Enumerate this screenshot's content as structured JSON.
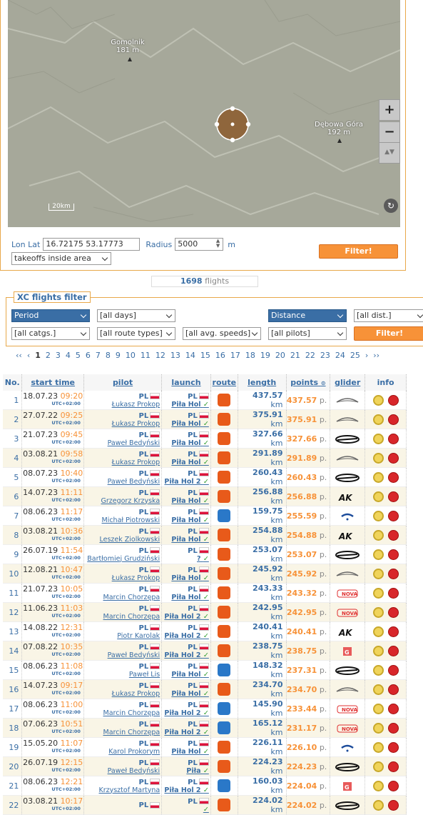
{
  "map": {
    "labels": [
      {
        "name": "Gomolnik",
        "sub": "181 m"
      },
      {
        "name": "Dębowa Góra",
        "sub": "192 m"
      }
    ],
    "scale": "20km",
    "zoom_in": "+",
    "zoom_out": "−",
    "rotate": "▲▼"
  },
  "filter_area": {
    "lonlat_label": "Lon Lat",
    "lonlat_value": "16.72175 53.17773",
    "radius_label": "Radius",
    "radius_value": "5000",
    "unit": "m",
    "mode": "takeoffs inside area",
    "button": "Filter!"
  },
  "flights_count": {
    "value": "1698",
    "label": "flights"
  },
  "xc_filter": {
    "title": "XC flights filter",
    "period": "Period",
    "days": "[all days]",
    "distance": "Distance",
    "dist": "[all dist.]",
    "catgs": "[all catgs.]",
    "route_types": "[all route types]",
    "avg_speeds": "[all avg. speeds]",
    "pilots": "[all pilots]",
    "button": "Filter!"
  },
  "pager": {
    "first": "‹‹",
    "prev": "‹",
    "pages": [
      "1",
      "2",
      "3",
      "4",
      "5",
      "6",
      "7",
      "8",
      "9",
      "10",
      "11",
      "12",
      "13",
      "14",
      "15",
      "16",
      "17",
      "18",
      "19",
      "20",
      "21",
      "22",
      "23",
      "24",
      "25"
    ],
    "current": "1",
    "next": "›",
    "last": "››"
  },
  "table": {
    "headers": {
      "no": "No.",
      "start": "start time",
      "pilot": "pilot",
      "launch": "launch",
      "route": "route",
      "length": "length",
      "points": "points",
      "glider": "glider",
      "info": "info"
    },
    "utc": "UTC+02:00",
    "km": "km",
    "p": "p.",
    "rows": [
      {
        "no": "1",
        "date": "18.07.23",
        "time": "09:20",
        "pcc": "PL",
        "pilot": "Łukasz Prokop",
        "lcc": "PL",
        "launch": "Piła Hol",
        "route": "r",
        "len": "437.57",
        "pts": "437.57",
        "glider": "ozone-outline"
      },
      {
        "no": "2",
        "date": "27.07.22",
        "time": "09:25",
        "pcc": "PL",
        "pilot": "Łukasz Prokop",
        "lcc": "PL",
        "launch": "Piła Hol",
        "route": "r",
        "len": "375.91",
        "pts": "375.91",
        "glider": "ozone-outline"
      },
      {
        "no": "3",
        "date": "21.07.23",
        "time": "09:45",
        "pcc": "PL",
        "pilot": "Paweł Bedyński",
        "lcc": "PL",
        "launch": "Piła Hol",
        "route": "r",
        "len": "327.66",
        "pts": "327.66",
        "glider": "ozone"
      },
      {
        "no": "4",
        "date": "03.08.21",
        "time": "09:58",
        "pcc": "PL",
        "pilot": "Łukasz Prokop",
        "lcc": "PL",
        "launch": "Piła Hol",
        "route": "r",
        "len": "291.89",
        "pts": "291.89",
        "glider": "ozone-outline"
      },
      {
        "no": "5",
        "date": "08.07.23",
        "time": "10:40",
        "pcc": "PL",
        "pilot": "Paweł Bedyński",
        "lcc": "PL",
        "launch": "Piła Hol 2",
        "route": "r",
        "len": "260.43",
        "pts": "260.43",
        "glider": "ozone"
      },
      {
        "no": "6",
        "date": "14.07.23",
        "time": "11:11",
        "pcc": "PL",
        "pilot": "Grzegorz Krzyska",
        "lcc": "PL",
        "launch": "Piła Hol",
        "route": "r",
        "len": "256.88",
        "pts": "256.88",
        "glider": "advance"
      },
      {
        "no": "7",
        "date": "08.06.23",
        "time": "11:17",
        "pcc": "PL",
        "pilot": "Michał Piotrowski",
        "lcc": "PL",
        "launch": "Piła Hol",
        "route": "b",
        "len": "159.75",
        "pts": "255.59",
        "glider": "skywalk"
      },
      {
        "no": "8",
        "date": "03.08.21",
        "time": "10:36",
        "pcc": "PL",
        "pilot": "Leszek Ziolkowski",
        "lcc": "PL",
        "launch": "Piła Hol",
        "route": "r",
        "len": "254.88",
        "pts": "254.88",
        "glider": "advance"
      },
      {
        "no": "9",
        "date": "26.07.19",
        "time": "11:54",
        "pcc": "PL",
        "pilot": "Bartłomiej Grudziński",
        "lcc": "PL",
        "launch": "?",
        "route": "r",
        "len": "253.07",
        "pts": "253.07",
        "glider": "ozone"
      },
      {
        "no": "10",
        "date": "12.08.21",
        "time": "10:47",
        "pcc": "PL",
        "pilot": "Łukasz Prokop",
        "lcc": "PL",
        "launch": "Piła Hol",
        "route": "r",
        "len": "245.92",
        "pts": "245.92",
        "glider": "ozone-outline"
      },
      {
        "no": "11",
        "date": "21.07.23",
        "time": "10:05",
        "pcc": "PL",
        "pilot": "Marcin Chorzępa",
        "lcc": "PL",
        "launch": "Piła Hol",
        "route": "r",
        "len": "243.33",
        "pts": "243.32",
        "glider": "nova"
      },
      {
        "no": "12",
        "date": "11.06.23",
        "time": "11:03",
        "pcc": "PL",
        "pilot": "Marcin Chorzępa",
        "lcc": "PL",
        "launch": "Piła Hol 2",
        "route": "r",
        "len": "242.95",
        "pts": "242.95",
        "glider": "nova"
      },
      {
        "no": "13",
        "date": "14.08.22",
        "time": "12:31",
        "pcc": "PL",
        "pilot": "Piotr Karolak",
        "lcc": "PL",
        "launch": "Piła Hol 2",
        "route": "r",
        "len": "240.41",
        "pts": "240.41",
        "glider": "advance"
      },
      {
        "no": "14",
        "date": "07.08.22",
        "time": "10:35",
        "pcc": "PL",
        "pilot": "Paweł Bedyński",
        "lcc": "PL",
        "launch": "Piła Hol 2",
        "route": "r",
        "len": "238.75",
        "pts": "238.75",
        "glider": "gin"
      },
      {
        "no": "15",
        "date": "08.06.23",
        "time": "11:08",
        "pcc": "PL",
        "pilot": "Paweł Lis",
        "lcc": "PL",
        "launch": "Piła Hol",
        "route": "b",
        "len": "148.32",
        "pts": "237.31",
        "glider": "ozone"
      },
      {
        "no": "16",
        "date": "14.07.23",
        "time": "09:17",
        "pcc": "PL",
        "pilot": "Łukasz Prokop",
        "lcc": "PL",
        "launch": "Piła Hol",
        "route": "r",
        "len": "234.70",
        "pts": "234.70",
        "glider": "ozone-outline"
      },
      {
        "no": "17",
        "date": "08.06.23",
        "time": "11:00",
        "pcc": "PL",
        "pilot": "Marcin Chorzępa",
        "lcc": "PL",
        "launch": "Piła Hol 2",
        "route": "b",
        "len": "145.90",
        "pts": "233.44",
        "glider": "nova"
      },
      {
        "no": "18",
        "date": "07.06.23",
        "time": "10:51",
        "pcc": "PL",
        "pilot": "Marcin Chorzępa",
        "lcc": "PL",
        "launch": "Piła Hol 2",
        "route": "b",
        "len": "165.12",
        "pts": "231.17",
        "glider": "nova"
      },
      {
        "no": "19",
        "date": "15.05.20",
        "time": "11:07",
        "pcc": "PL",
        "pilot": "Karol Prokorym",
        "lcc": "PL",
        "launch": "Piła Hol",
        "route": "r",
        "len": "226.11",
        "pts": "226.10",
        "glider": "skywalk"
      },
      {
        "no": "20",
        "date": "26.07.19",
        "time": "12:15",
        "pcc": "PL",
        "pilot": "Paweł Bedyński",
        "lcc": "PL",
        "launch": "Piła",
        "route": "r",
        "len": "224.23",
        "pts": "224.23",
        "glider": "ozone"
      },
      {
        "no": "21",
        "date": "08.06.23",
        "time": "12:21",
        "pcc": "PL",
        "pilot": "Krzysztof Martyna",
        "lcc": "PL",
        "launch": "Piła Hol 2",
        "route": "b",
        "len": "160.03",
        "pts": "224.04",
        "glider": "gin"
      },
      {
        "no": "22",
        "date": "03.08.21",
        "time": "10:17",
        "pcc": "PL",
        "pilot": "",
        "lcc": "PL",
        "launch": "",
        "route": "r",
        "len": "224.02",
        "pts": "224.02",
        "glider": "ozone"
      }
    ]
  }
}
